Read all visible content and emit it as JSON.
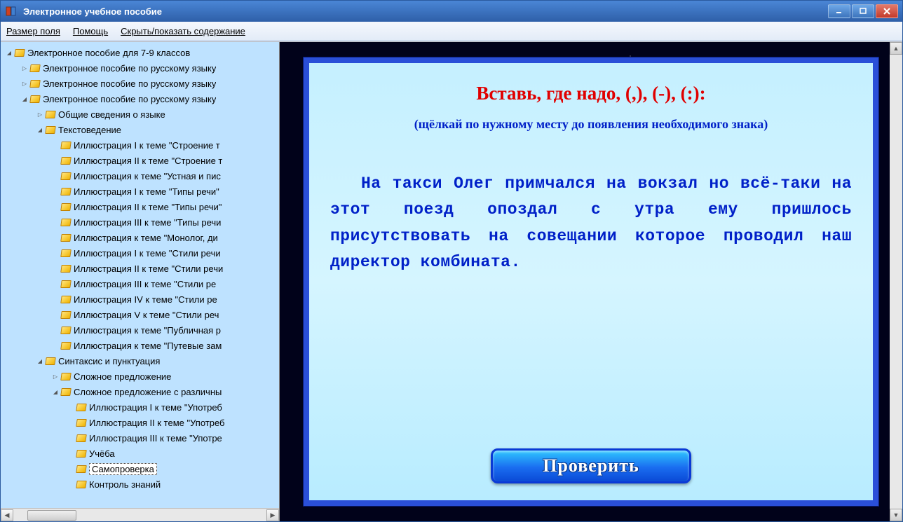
{
  "title": "Электронное учебное пособие",
  "menu": {
    "field_size": "Размер поля",
    "help": "Помощь",
    "toggle_toc": "Скрыть/показать содержание"
  },
  "tree": [
    {
      "d": 0,
      "e": "open",
      "t": "Электронное пособие для 7-9 классов"
    },
    {
      "d": 1,
      "e": "closed",
      "t": "Электронное пособие по русскому языку"
    },
    {
      "d": 1,
      "e": "closed",
      "t": "Электронное пособие по русскому языку"
    },
    {
      "d": 1,
      "e": "open",
      "t": "Электронное пособие по русскому языку"
    },
    {
      "d": 2,
      "e": "closed",
      "t": "Общие сведения о языке"
    },
    {
      "d": 2,
      "e": "open",
      "t": "Текстоведение"
    },
    {
      "d": 3,
      "e": "none",
      "t": "Иллюстрация I к теме \"Строение т"
    },
    {
      "d": 3,
      "e": "none",
      "t": "Иллюстрация II к теме \"Строение т"
    },
    {
      "d": 3,
      "e": "none",
      "t": "Иллюстрация к теме \"Устная и пис"
    },
    {
      "d": 3,
      "e": "none",
      "t": "Иллюстрация I к теме \"Типы речи\""
    },
    {
      "d": 3,
      "e": "none",
      "t": "Иллюстрация II к теме \"Типы речи\""
    },
    {
      "d": 3,
      "e": "none",
      "t": "Иллюстрация III к теме \"Типы речи"
    },
    {
      "d": 3,
      "e": "none",
      "t": "Иллюстрация к теме \"Монолог, ди"
    },
    {
      "d": 3,
      "e": "none",
      "t": "Иллюстрация I к теме \"Стили речи"
    },
    {
      "d": 3,
      "e": "none",
      "t": "Иллюстрация II к теме \"Стили речи"
    },
    {
      "d": 3,
      "e": "none",
      "t": "Иллюстрация III к теме \"Стили ре"
    },
    {
      "d": 3,
      "e": "none",
      "t": "Иллюстрация IV к теме \"Стили ре"
    },
    {
      "d": 3,
      "e": "none",
      "t": "Иллюстрация V к теме \"Стили реч"
    },
    {
      "d": 3,
      "e": "none",
      "t": "Иллюстрация к теме \"Публичная р"
    },
    {
      "d": 3,
      "e": "none",
      "t": "Иллюстрация к теме \"Путевые зам"
    },
    {
      "d": 2,
      "e": "open",
      "t": "Синтаксис и пунктуация"
    },
    {
      "d": 3,
      "e": "closed",
      "t": "Сложное предложение"
    },
    {
      "d": 3,
      "e": "open",
      "t": "Сложное предложение с различны"
    },
    {
      "d": 4,
      "e": "none",
      "t": "Иллюстрация I к теме \"Употреб"
    },
    {
      "d": 4,
      "e": "none",
      "t": "Иллюстрация II к теме \"Употреб"
    },
    {
      "d": 4,
      "e": "none",
      "t": "Иллюстрация III к теме \"Употре"
    },
    {
      "d": 4,
      "e": "none",
      "t": "Учёба"
    },
    {
      "d": 4,
      "e": "none",
      "t": "Самопроверка",
      "sel": true
    },
    {
      "d": 4,
      "e": "none",
      "t": "Контроль знаний"
    }
  ],
  "slide": {
    "title": "Вставь, где надо, (,), (-), (:):",
    "subtitle": "(щёлкай по нужному месту до появления необходимого знака)",
    "text": "На такси Олег примчался на вокзал но всё-таки на этот поезд опоздал с утра ему пришлось присутствовать на совещании которое проводил наш директор комбината.",
    "button": "Проверить"
  }
}
